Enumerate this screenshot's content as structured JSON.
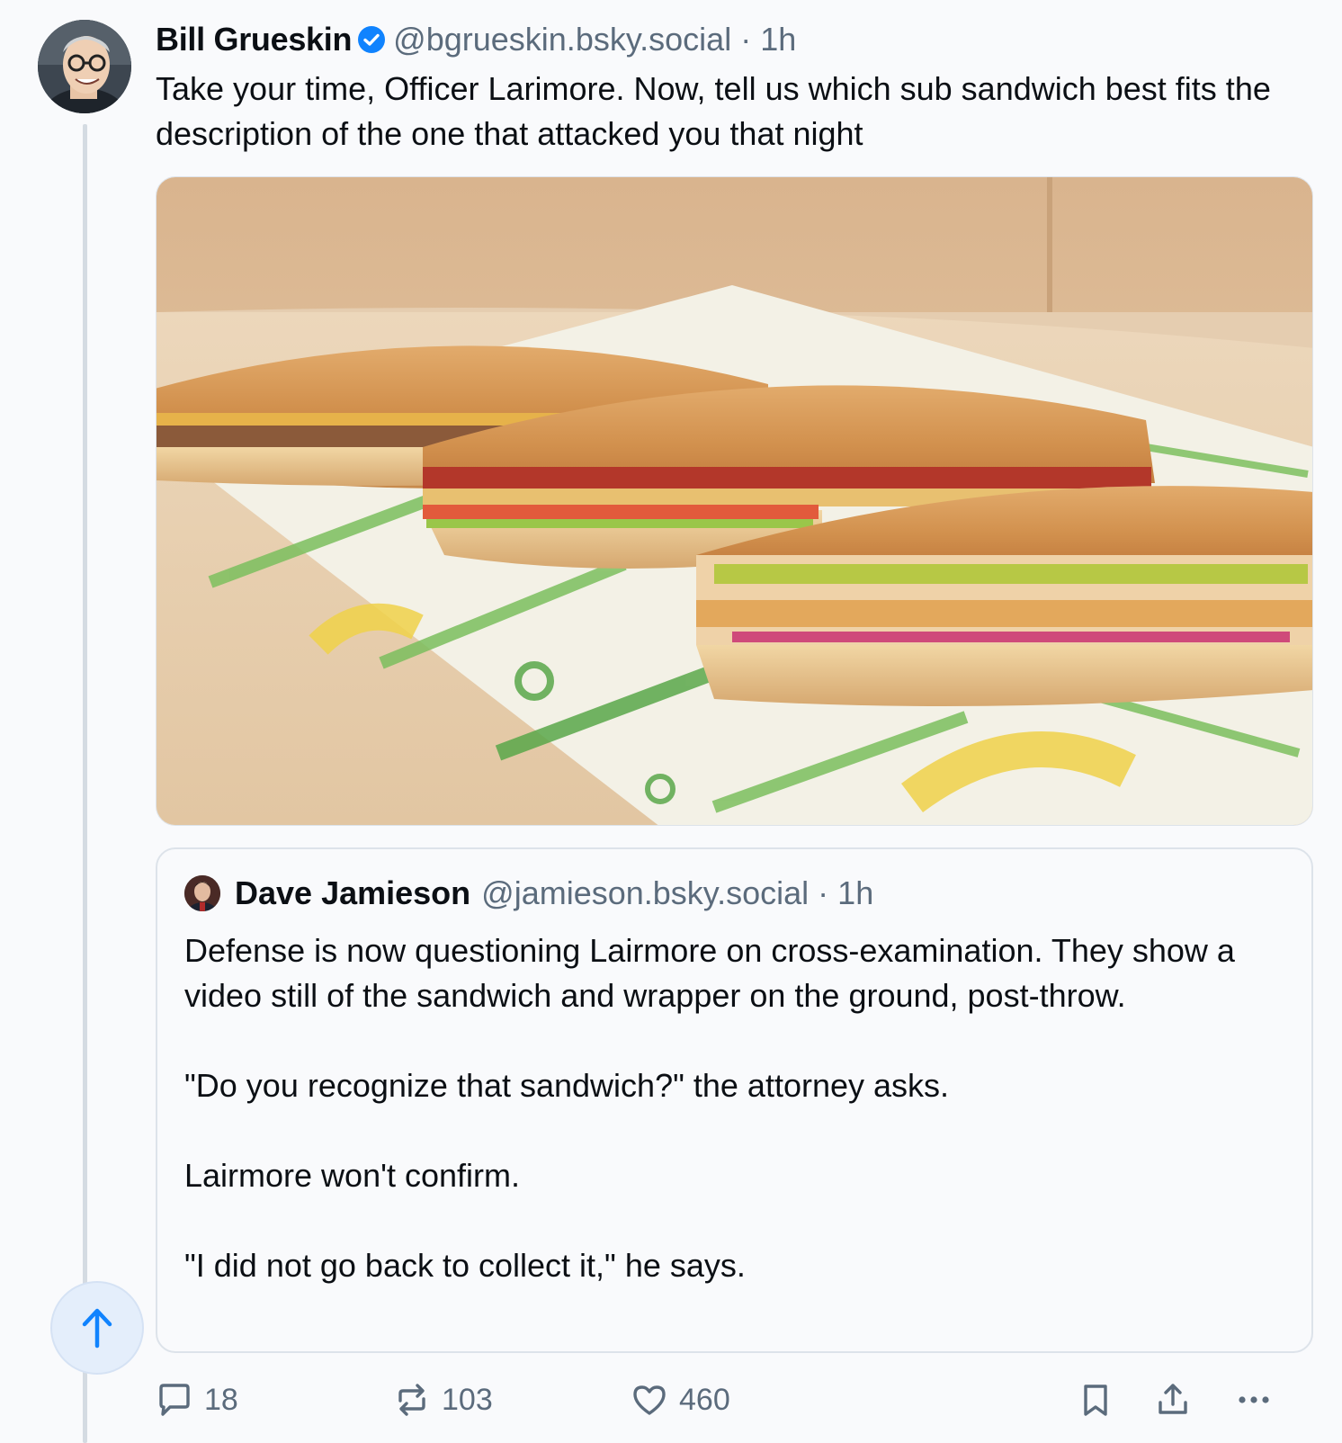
{
  "post": {
    "author": {
      "display_name": "Bill Grueskin",
      "handle": "@bgrueskin.bsky.social",
      "verified": true
    },
    "separator": "·",
    "timestamp": "1h",
    "text": "Take your time, Officer Larimore. Now, tell us which sub sandwich best fits the description of the one that attacked you that night",
    "image": {
      "description_icon": "subway-sandwiches-photo"
    },
    "quoted_post": {
      "author": {
        "display_name": "Dave Jamieson",
        "handle": "@jamieson.bsky.social"
      },
      "separator": "·",
      "timestamp": "1h",
      "paragraphs": [
        "Defense is now questioning Lairmore on cross-examination. They show a video still of the sandwich and wrapper on the ground, post-throw.",
        "\"Do you recognize that sandwich?\" the attorney asks.",
        "Lairmore won't confirm.",
        "\"I did not go back to collect it,\" he says."
      ]
    },
    "actions": {
      "reply_count": "18",
      "repost_count": "103",
      "like_count": "460"
    }
  },
  "colors": {
    "text_primary": "#0b0f14",
    "text_secondary": "#5b6b7c",
    "verified_blue": "#1083fe",
    "accent_blue": "#1083fe",
    "background": "#f9fafc",
    "border": "#dde3ea"
  }
}
